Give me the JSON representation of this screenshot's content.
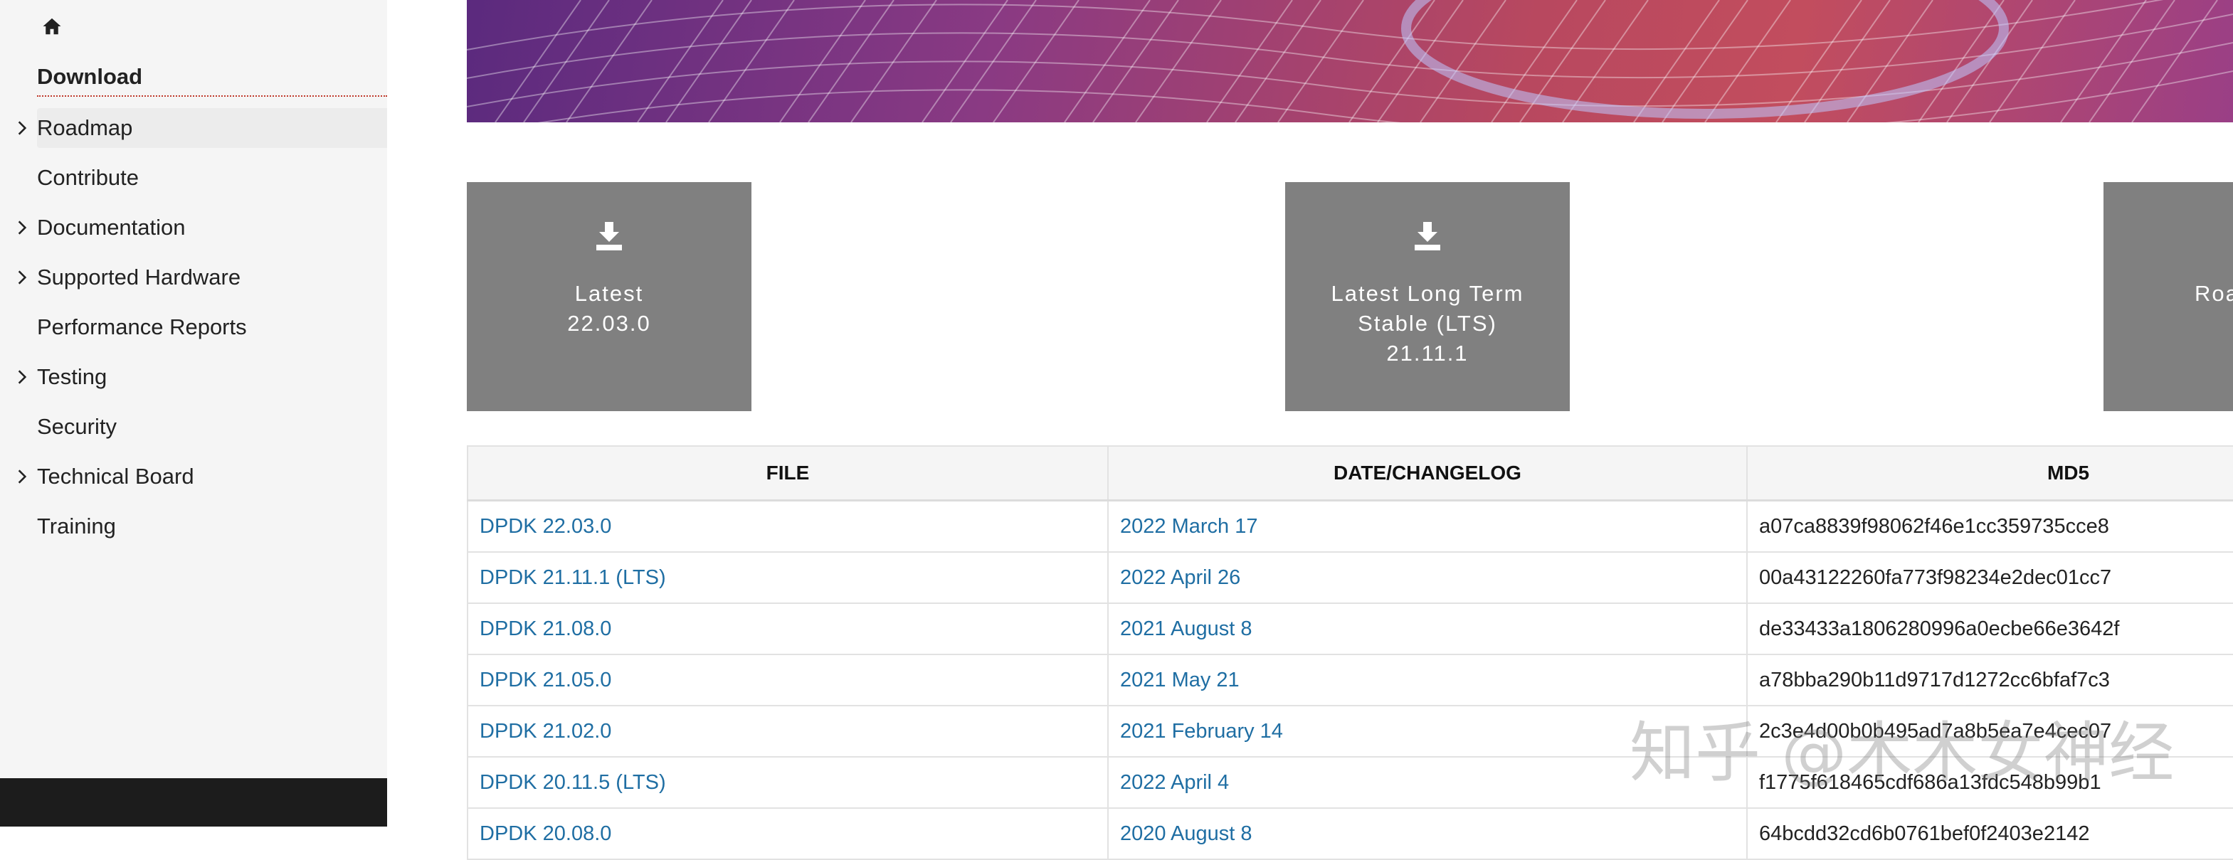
{
  "sidebar": {
    "home_icon": "home-icon",
    "items": [
      {
        "label": "Download",
        "expandable": false,
        "active": true
      },
      {
        "label": "Roadmap",
        "expandable": true,
        "highlighted": true
      },
      {
        "label": "Contribute",
        "expandable": false
      },
      {
        "label": "Documentation",
        "expandable": true
      },
      {
        "label": "Supported Hardware",
        "expandable": true
      },
      {
        "label": "Performance Reports",
        "expandable": false
      },
      {
        "label": "Testing",
        "expandable": true
      },
      {
        "label": "Security",
        "expandable": false
      },
      {
        "label": "Technical Board",
        "expandable": true
      },
      {
        "label": "Training",
        "expandable": false
      }
    ]
  },
  "tiles": [
    {
      "icon": "download-icon",
      "lines": [
        "Latest",
        "22.03.0"
      ]
    },
    {
      "icon": "download-icon",
      "lines": [
        "Latest Long Term",
        "Stable (LTS)",
        "21.11.1"
      ]
    },
    {
      "icon": "download-icon",
      "lines": [
        "Roa"
      ]
    }
  ],
  "table": {
    "headers": [
      "FILE",
      "DATE/CHANGELOG",
      "MD5"
    ],
    "rows": [
      {
        "file": "DPDK 22.03.0",
        "date": "2022 March 17",
        "md5": "a07ca8839f98062f46e1cc359735cce8"
      },
      {
        "file": "DPDK 21.11.1 (LTS)",
        "date": "2022 April 26",
        "md5": "00a43122260fa773f98234e2dec01cc7"
      },
      {
        "file": "DPDK 21.08.0",
        "date": "2021 August 8",
        "md5": "de33433a1806280996a0ecbe66e3642f"
      },
      {
        "file": "DPDK 21.05.0",
        "date": "2021 May 21",
        "md5": "a78bba290b11d9717d1272cc6bfaf7c3"
      },
      {
        "file": "DPDK 21.02.0",
        "date": "2021 February 14",
        "md5": "2c3e4d00b0b495ad7a8b5ea7e4cec07"
      },
      {
        "file": "DPDK 20.11.5 (LTS)",
        "date": "2022 April 4",
        "md5": "f1775f618465cdf686a13fdc548b99b1"
      },
      {
        "file": "DPDK 20.08.0",
        "date": "2020 August 8",
        "md5": "64bcdd32cd6b0761bef0f2403e2142"
      }
    ]
  },
  "watermark": "知乎 @木木女神经",
  "colors": {
    "sidebar_bg": "#f5f5f5",
    "tile_bg": "#808080",
    "link": "#1f6ea3",
    "active_underline": "#c0392b"
  }
}
